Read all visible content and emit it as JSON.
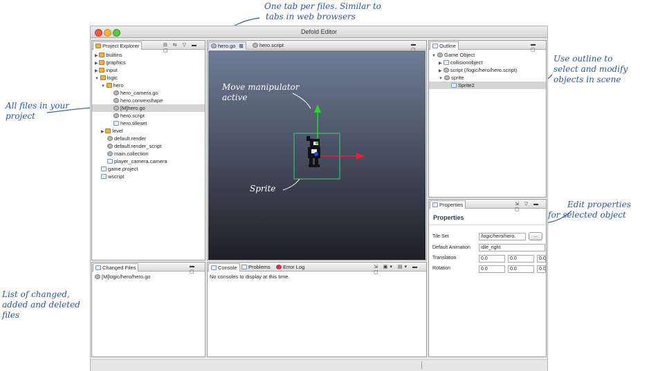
{
  "window": {
    "title": "Defold Editor"
  },
  "annotations": {
    "tabs_line1": "One tab per files. Similar to",
    "tabs_line2": "tabs in web browsers",
    "files_line1": "All files in your",
    "files_line2": "project",
    "changed_line1": "List of changed,",
    "changed_line2": "added and deleted",
    "changed_line3": "files",
    "manip_line1": "Move manipulator",
    "manip_line2": "active",
    "sprite": "Sprite",
    "outline_line1": "Use outline to",
    "outline_line2": "select and modify",
    "outline_line3": "objects in scene",
    "props_line1": "Edit properties",
    "props_line2": "for selected object"
  },
  "project_explorer": {
    "title": "Project Explorer",
    "items": [
      {
        "label": "builtins",
        "type": "folder",
        "expanded": false
      },
      {
        "label": "graphics",
        "type": "folder",
        "expanded": false
      },
      {
        "label": "input",
        "type": "folder",
        "expanded": false
      },
      {
        "label": "logic",
        "type": "folder",
        "expanded": true
      },
      {
        "label": "hero",
        "type": "folder",
        "expanded": true
      },
      {
        "label": "hero_camera.go",
        "type": "file"
      },
      {
        "label": "hero.convexshape",
        "type": "file"
      },
      {
        "label": "[M]hero.go",
        "type": "file",
        "selected": true
      },
      {
        "label": "hero.script",
        "type": "file"
      },
      {
        "label": "hero.tilleset",
        "type": "file"
      },
      {
        "label": "level",
        "type": "folder",
        "expanded": false
      },
      {
        "label": "default.render",
        "type": "file"
      },
      {
        "label": "default.render_script",
        "type": "file"
      },
      {
        "label": "main.collection",
        "type": "file"
      },
      {
        "label": "player_camera.camera",
        "type": "file"
      },
      {
        "label": "game.project",
        "type": "file"
      },
      {
        "label": "wscript",
        "type": "file"
      }
    ]
  },
  "changed_files": {
    "title": "Changed Files",
    "items": [
      "[M]logic/hero/hero.go"
    ]
  },
  "editor": {
    "tabs": [
      "hero.go",
      "hero.script"
    ],
    "active_tab": "hero.go"
  },
  "outline": {
    "title": "Outline",
    "items": [
      {
        "label": "Game Object"
      },
      {
        "label": "collisionobject"
      },
      {
        "label": "script (/logic/hero/hero.script)"
      },
      {
        "label": "sprite"
      },
      {
        "label": "Sprite2",
        "selected": true
      }
    ]
  },
  "properties": {
    "tab": "Properties",
    "heading": "Properties",
    "tile_set_label": "Tile Set",
    "tile_set_value": "/logic/hero/hero.",
    "browse_label": "...",
    "default_animation_label": "Default Animation",
    "default_animation_value": "idle_right",
    "translation_label": "Translation",
    "translation": [
      "0.0",
      "0.0",
      "0.0"
    ],
    "rotation_label": "Rotation",
    "rotation": [
      "0.0",
      "0.0",
      "0.0"
    ]
  },
  "console": {
    "tabs": [
      "Console",
      "Problems",
      "Error Log"
    ],
    "message": "No consoles to display at this time."
  }
}
